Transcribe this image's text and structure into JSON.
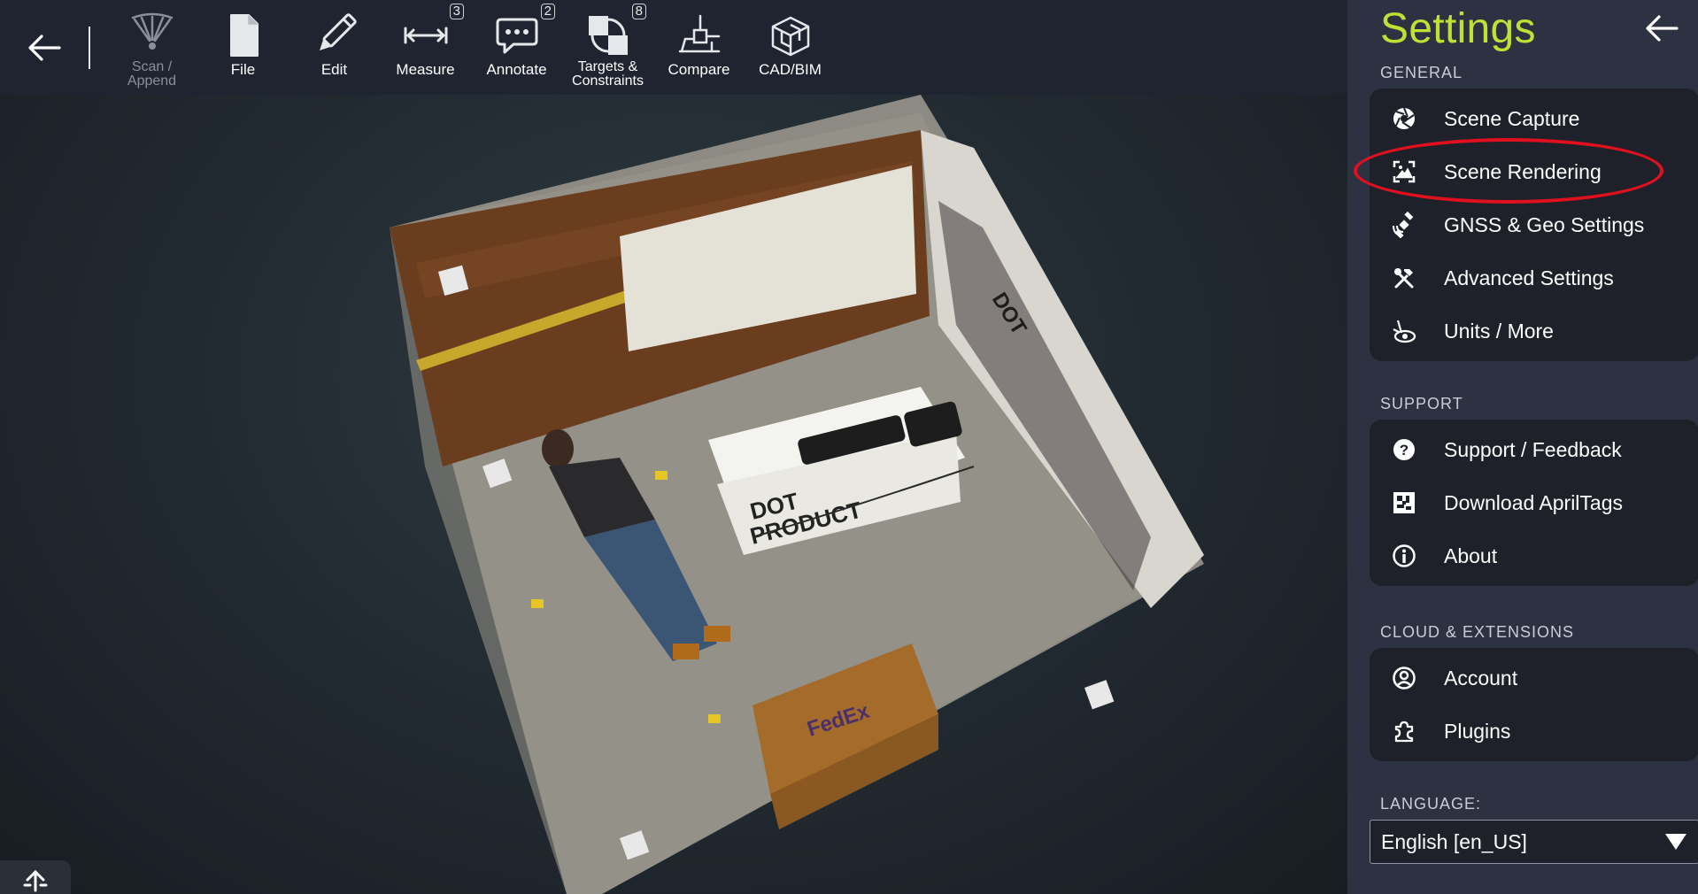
{
  "toolbar": {
    "back_label": "",
    "tools": [
      {
        "label_line1": "Scan /",
        "label_line2": "Append",
        "icon": "scan-icon",
        "disabled": true
      },
      {
        "label": "File",
        "icon": "file-icon"
      },
      {
        "label": "Edit",
        "icon": "pencil-icon"
      },
      {
        "label": "Measure",
        "icon": "measure-icon",
        "badge": "3"
      },
      {
        "label": "Annotate",
        "icon": "annotate-icon",
        "badge": "2"
      },
      {
        "label_line1": "Targets &",
        "label_line2": "Constraints",
        "icon": "targets-icon",
        "badge": "8"
      },
      {
        "label": "Compare",
        "icon": "compare-icon"
      },
      {
        "label": "CAD/BIM",
        "icon": "cad-bim-icon"
      }
    ]
  },
  "scene": {
    "banner_text_1": "DOT",
    "banner_text_2": "PRODUCT",
    "box_text": "FedEx"
  },
  "settings": {
    "title": "Settings",
    "general_label": "GENERAL",
    "general_items": [
      {
        "label": "Scene Capture",
        "icon": "aperture-icon"
      },
      {
        "label": "Scene Rendering",
        "icon": "image-frame-icon",
        "highlighted": true
      },
      {
        "label": "GNSS & Geo Settings",
        "icon": "satellite-icon"
      },
      {
        "label": "Advanced Settings",
        "icon": "tools-icon"
      },
      {
        "label": "Units / More",
        "icon": "units-icon"
      }
    ],
    "support_label": "SUPPORT",
    "support_items": [
      {
        "label": "Support / Feedback",
        "icon": "help-icon"
      },
      {
        "label": "Download AprilTags",
        "icon": "apriltag-icon"
      },
      {
        "label": "About",
        "icon": "info-icon"
      }
    ],
    "cloud_label": "CLOUD & EXTENSIONS",
    "cloud_items": [
      {
        "label": "Account",
        "icon": "account-icon"
      },
      {
        "label": "Plugins",
        "icon": "puzzle-icon"
      }
    ],
    "language_label": "LANGUAGE:",
    "language_value": "English [en_US]"
  },
  "colors": {
    "toolbar_bg": "#202431",
    "panel_bg": "#2d3242",
    "group_bg": "#1e2129",
    "accent_title": "#bfe035",
    "highlight_ring": "#e0101e"
  }
}
